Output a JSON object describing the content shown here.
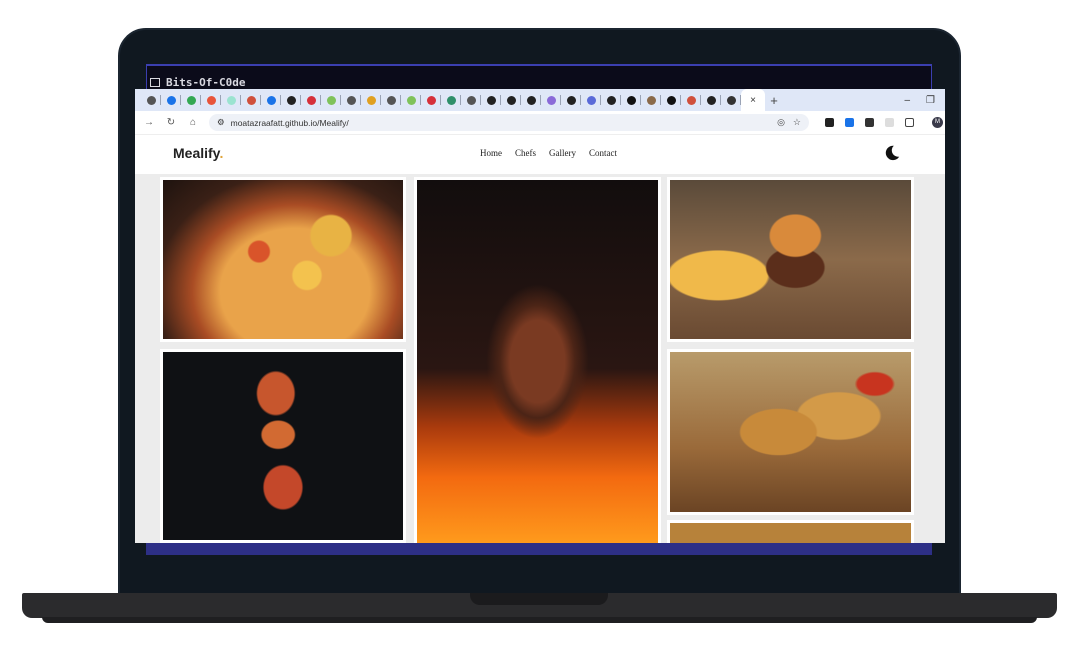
{
  "terminal": {
    "title": "Bits-Of-C0de"
  },
  "browser": {
    "tabs": [
      {
        "icon": "chrome-icon",
        "color": "#555555"
      },
      {
        "icon": "drive-icon",
        "color": "#1a73e8"
      },
      {
        "icon": "drive-icon",
        "color": "#34a853"
      },
      {
        "icon": "app-icon",
        "color": "#e8543a"
      },
      {
        "icon": "app-icon",
        "color": "#9be3d0"
      },
      {
        "icon": "vite-icon",
        "color": "#d0503c"
      },
      {
        "icon": "app-icon",
        "color": "#1a73e8"
      },
      {
        "icon": "github-icon",
        "color": "#222222"
      },
      {
        "icon": "app-icon",
        "color": "#d6303a"
      },
      {
        "icon": "app-icon",
        "color": "#7fc25a"
      },
      {
        "icon": "globe-icon",
        "color": "#555555"
      },
      {
        "icon": "bookmark-icon",
        "color": "#e0a020"
      },
      {
        "icon": "globe-icon",
        "color": "#555555"
      },
      {
        "icon": "app-icon",
        "color": "#7fc25a"
      },
      {
        "icon": "app-icon",
        "color": "#d6303a"
      },
      {
        "icon": "app-icon",
        "color": "#2f8f6a"
      },
      {
        "icon": "globe-icon",
        "color": "#555555"
      },
      {
        "icon": "github-icon",
        "color": "#222222"
      },
      {
        "icon": "github-icon",
        "color": "#222222"
      },
      {
        "icon": "github-icon",
        "color": "#222222"
      },
      {
        "icon": "app-icon",
        "color": "#8a6ad8"
      },
      {
        "icon": "app-icon",
        "color": "#222222"
      },
      {
        "icon": "app-icon",
        "color": "#5a6ad8"
      },
      {
        "icon": "app-icon",
        "color": "#222222"
      },
      {
        "icon": "app-icon",
        "color": "#111111"
      },
      {
        "icon": "app-icon",
        "color": "#8a6a4a"
      },
      {
        "icon": "app-icon",
        "color": "#111111"
      },
      {
        "icon": "vite-icon",
        "color": "#d0503c"
      },
      {
        "icon": "github-icon",
        "color": "#222222"
      },
      {
        "icon": "app-icon",
        "color": "#333333"
      }
    ],
    "active_tab_close": "×",
    "new_tab": "+",
    "window_minimize": "–",
    "window_restore": "❐",
    "url": "moatazraafatt.github.io/Mealify/",
    "avatar_initial": "M"
  },
  "site": {
    "logo": "Mealify",
    "logo_dot": ".",
    "menu": [
      "Home",
      "Chefs",
      "Gallery",
      "Contact"
    ],
    "accent_color": "#e0a43a"
  },
  "gallery": [
    {
      "name": "pizza-slice-photo"
    },
    {
      "name": "floating-pizza-photo"
    },
    {
      "name": "grilled-steak-fire-photo"
    },
    {
      "name": "burger-fries-photo"
    },
    {
      "name": "fried-chicken-photo"
    }
  ]
}
